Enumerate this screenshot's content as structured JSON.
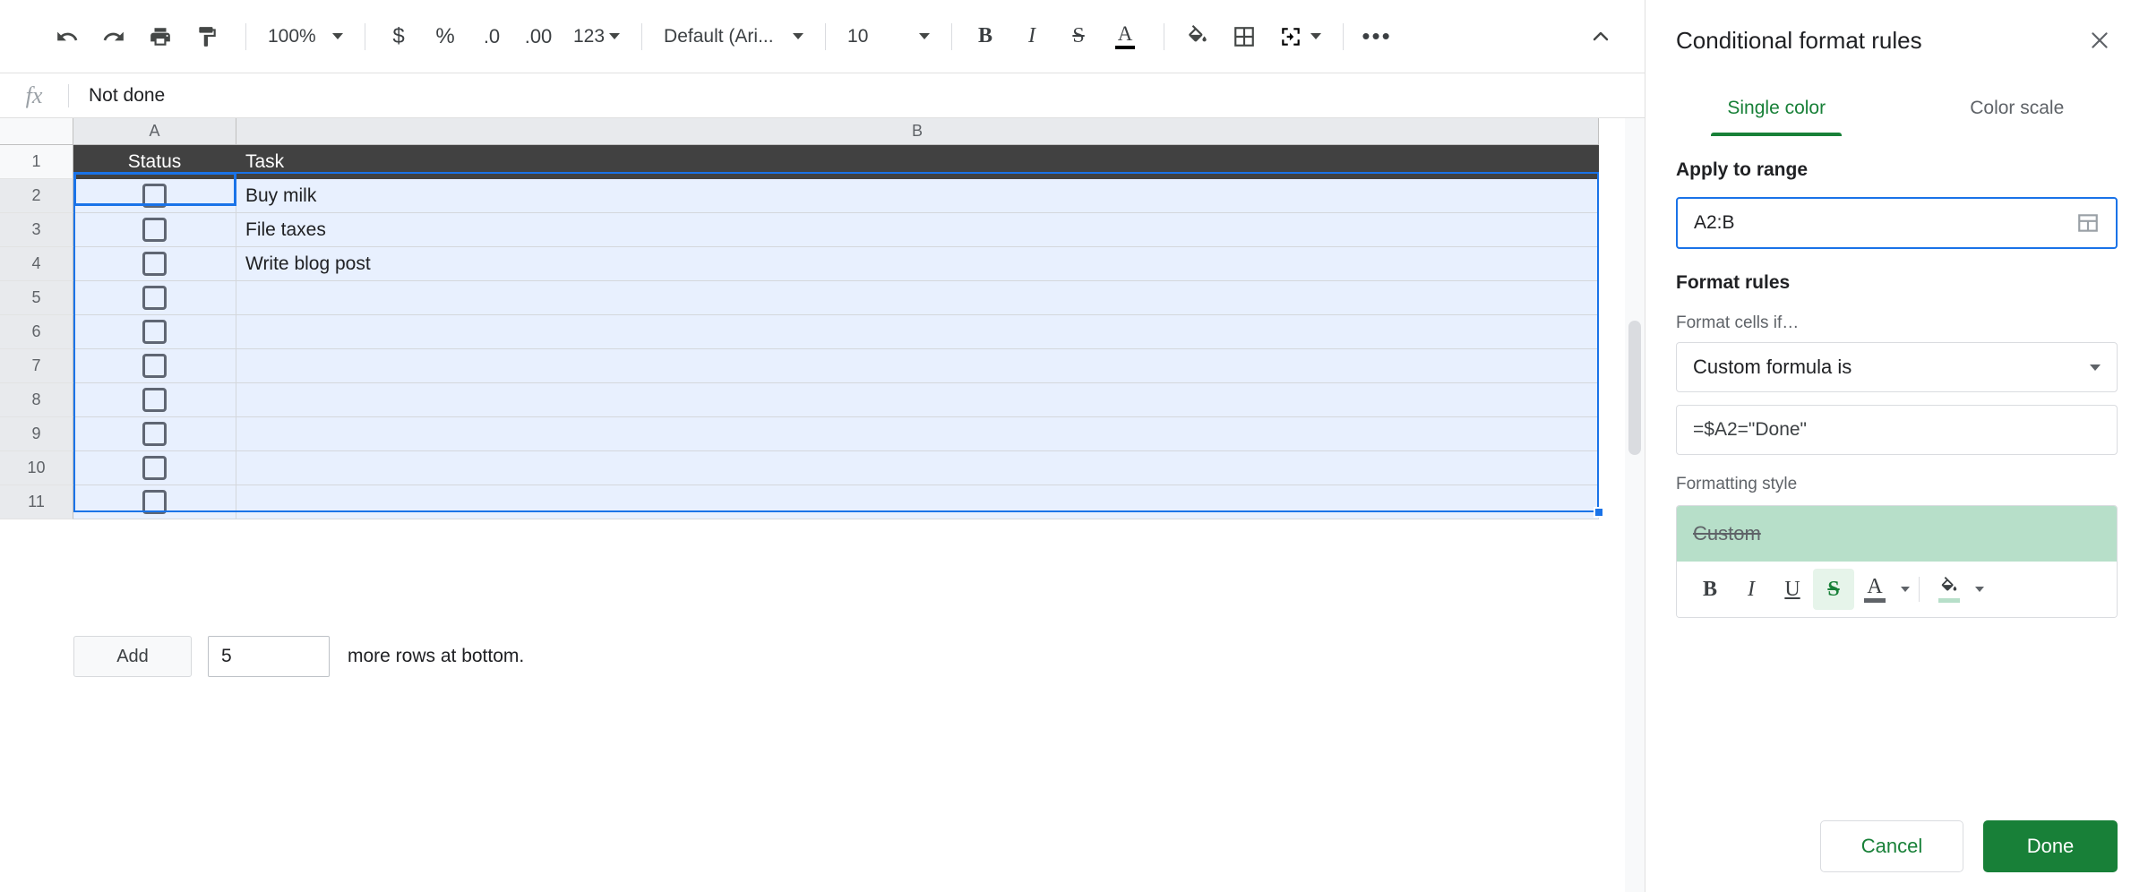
{
  "toolbar": {
    "undo_icon": "undo-icon",
    "redo_icon": "redo-icon",
    "print_icon": "print-icon",
    "paint_format_icon": "paint-format-icon",
    "zoom_value": "100%",
    "currency_label": "$",
    "percent_label": "%",
    "decimal_decrease_label": ".0",
    "decimal_increase_label": ".00",
    "number_format_label": "123",
    "font_value": "Default (Ari...",
    "font_size_value": "10",
    "bold_label": "B",
    "italic_label": "I",
    "strikethrough_label": "S",
    "text_color_label": "A",
    "fill_color_icon": "fill-color-icon",
    "borders_icon": "borders-icon",
    "merge_cells_icon": "merge-cells-icon",
    "more_label": "•••",
    "collapse_icon": "chevron-up-icon"
  },
  "formula_bar": {
    "fx_label": "fx",
    "value": "Not done"
  },
  "grid": {
    "columns": [
      "A",
      "B"
    ],
    "header_row_number": "1",
    "header_cells": [
      "Status",
      "Task"
    ],
    "rows": [
      {
        "num": "2",
        "checkbox": true,
        "task": "Buy milk"
      },
      {
        "num": "3",
        "checkbox": true,
        "task": "File taxes"
      },
      {
        "num": "4",
        "checkbox": true,
        "task": "Write blog post"
      },
      {
        "num": "5",
        "checkbox": true,
        "task": ""
      },
      {
        "num": "6",
        "checkbox": true,
        "task": ""
      },
      {
        "num": "7",
        "checkbox": true,
        "task": ""
      },
      {
        "num": "8",
        "checkbox": true,
        "task": ""
      },
      {
        "num": "9",
        "checkbox": true,
        "task": ""
      },
      {
        "num": "10",
        "checkbox": true,
        "task": ""
      },
      {
        "num": "11",
        "checkbox": true,
        "task": ""
      }
    ],
    "selection_range": "A2:B11"
  },
  "add_rows": {
    "button_label": "Add",
    "count_value": "5",
    "trailing_text": "more rows at bottom."
  },
  "sidebar": {
    "title": "Conditional format rules",
    "close_icon": "close-icon",
    "tabs": [
      {
        "label": "Single color",
        "active": true
      },
      {
        "label": "Color scale",
        "active": false
      }
    ],
    "apply_to_range": {
      "label": "Apply to range",
      "value": "A2:B",
      "picker_icon": "grid-picker-icon"
    },
    "format_rules": {
      "title": "Format rules",
      "condition_label": "Format cells if…",
      "condition_value": "Custom formula is",
      "formula_value": "=$A2=\"Done\""
    },
    "formatting_style": {
      "label": "Formatting style",
      "preview_text": "Custom",
      "preview_bg": "#b7dfc9",
      "tools": {
        "bold": "B",
        "italic": "I",
        "underline": "U",
        "strikethrough": "S",
        "text_color": "A",
        "text_color_swatch": "#5f6368",
        "fill_color_icon": "fill-color-icon",
        "fill_color_swatch": "#b7dfc9"
      },
      "active_tool": "strikethrough"
    },
    "footer": {
      "cancel_label": "Cancel",
      "done_label": "Done"
    },
    "accent_color": "#188038"
  }
}
